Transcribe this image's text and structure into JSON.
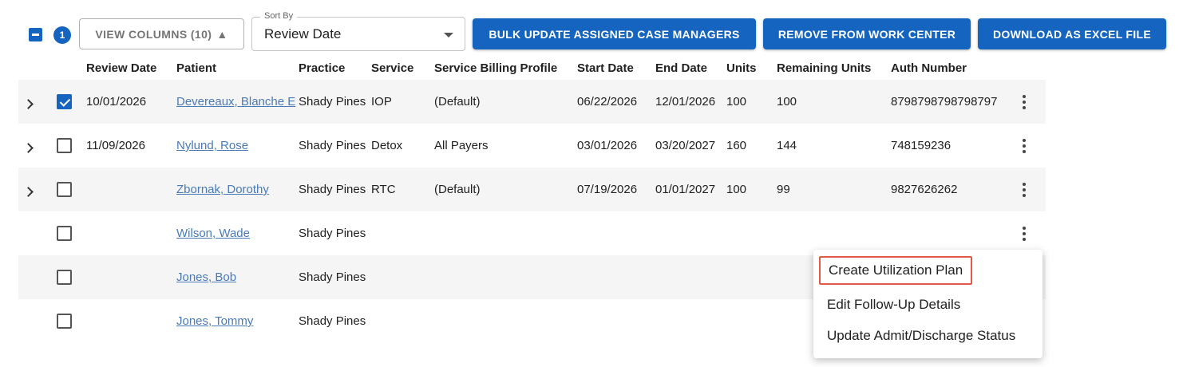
{
  "toolbar": {
    "selected_count": "1",
    "view_columns_label": "VIEW COLUMNS (10)",
    "view_columns_icon": "▲",
    "sort_by": {
      "legend": "Sort By",
      "value": "Review Date"
    },
    "bulk_update_label": "BULK UPDATE ASSIGNED CASE MANAGERS",
    "remove_label": "REMOVE FROM WORK CENTER",
    "download_label": "DOWNLOAD AS EXCEL FILE"
  },
  "table": {
    "headers": [
      "Review Date",
      "Patient",
      "Practice",
      "Service",
      "Service Billing Profile",
      "Start Date",
      "End Date",
      "Units",
      "Remaining Units",
      "Auth Number"
    ],
    "rows": [
      {
        "expandable": true,
        "checked": true,
        "review_date": "10/01/2026",
        "patient": "Devereaux, Blanche E",
        "practice": "Shady Pines",
        "service": "IOP",
        "billing_profile": "(Default)",
        "start_date": "06/22/2026",
        "end_date": "12/01/2026",
        "units": "100",
        "remaining_units": "100",
        "auth_number": "8798798798798797"
      },
      {
        "expandable": true,
        "checked": false,
        "review_date": "11/09/2026",
        "patient": "Nylund, Rose",
        "practice": "Shady Pines",
        "service": "Detox",
        "billing_profile": "All Payers",
        "start_date": "03/01/2026",
        "end_date": "03/20/2027",
        "units": "160",
        "remaining_units": "144",
        "auth_number": "748159236"
      },
      {
        "expandable": true,
        "checked": false,
        "review_date": "",
        "patient": "Zbornak, Dorothy",
        "practice": "Shady Pines",
        "service": "RTC",
        "billing_profile": "(Default)",
        "start_date": "07/19/2026",
        "end_date": "01/01/2027",
        "units": "100",
        "remaining_units": "99",
        "auth_number": "9827626262"
      },
      {
        "expandable": false,
        "checked": false,
        "review_date": "",
        "patient": "Wilson, Wade",
        "practice": "Shady Pines",
        "service": "",
        "billing_profile": "",
        "start_date": "",
        "end_date": "",
        "units": "",
        "remaining_units": "",
        "auth_number": ""
      },
      {
        "expandable": false,
        "checked": false,
        "review_date": "",
        "patient": "Jones, Bob",
        "practice": "Shady Pines",
        "service": "",
        "billing_profile": "",
        "start_date": "",
        "end_date": "",
        "units": "",
        "remaining_units": "",
        "auth_number": ""
      },
      {
        "expandable": false,
        "checked": false,
        "review_date": "",
        "patient": "Jones, Tommy",
        "practice": "Shady Pines",
        "service": "",
        "billing_profile": "",
        "start_date": "",
        "end_date": "",
        "units": "",
        "remaining_units": "",
        "auth_number": ""
      }
    ]
  },
  "context_menu": {
    "items": [
      "Create Utilization Plan",
      "Edit Follow-Up Details",
      "Update Admit/Discharge Status"
    ]
  },
  "colors": {
    "primary": "#1565c0",
    "link": "#4a7ab8",
    "highlight_border": "#e25a4a",
    "row_shade": "#f5f5f5"
  }
}
